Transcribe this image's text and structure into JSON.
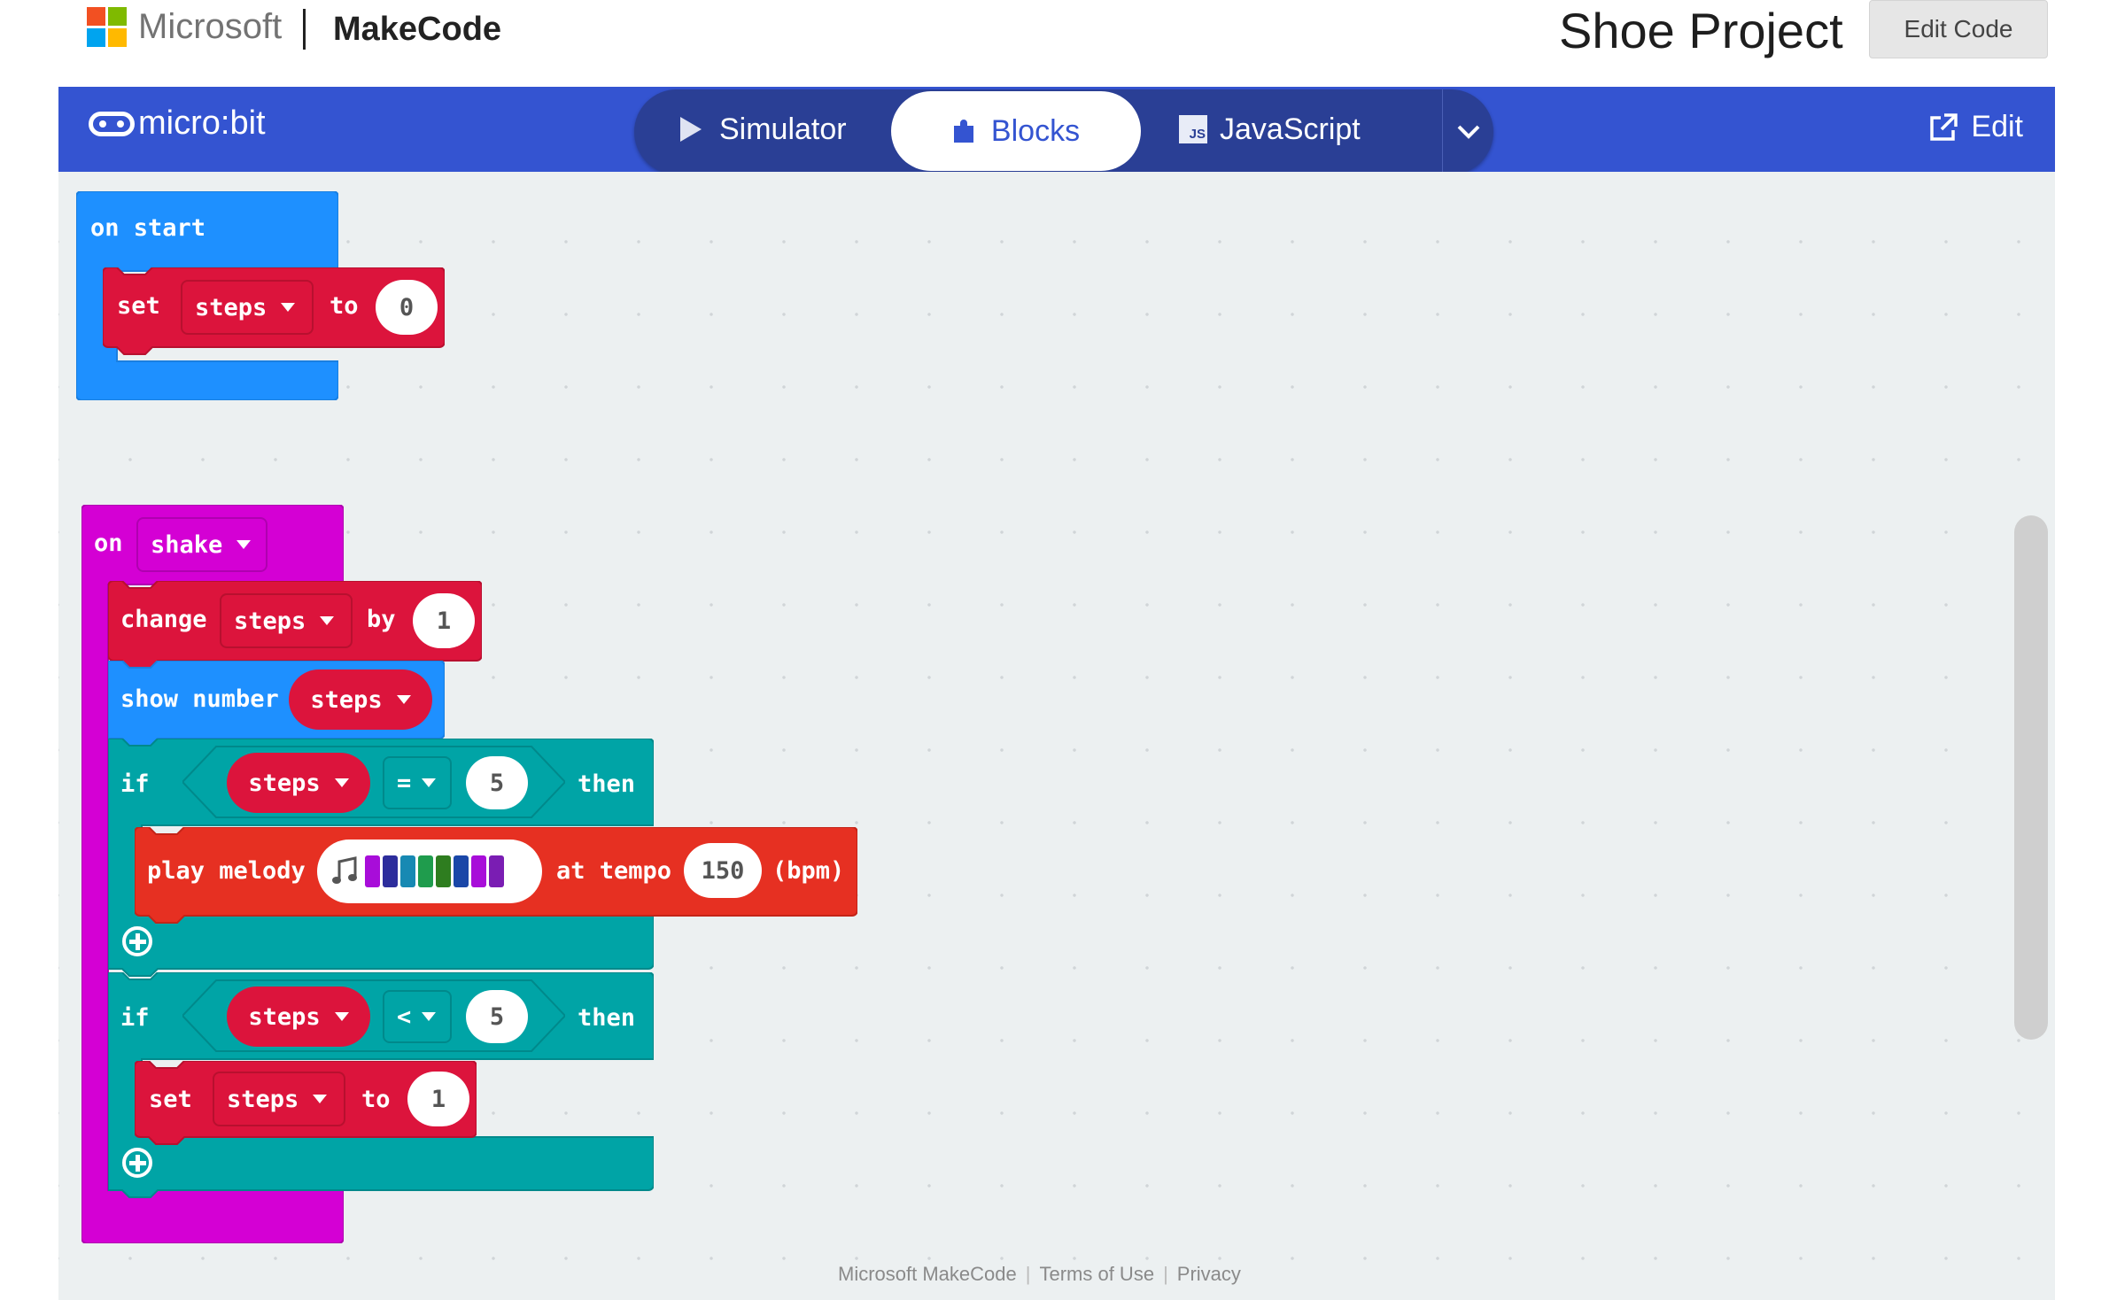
{
  "header": {
    "brand_company": "Microsoft",
    "brand_product": "MakeCode",
    "project_title": "Shoe Project",
    "edit_code_label": "Edit Code"
  },
  "topbar": {
    "logo_text": "micro:bit",
    "tabs": [
      {
        "label": "Simulator",
        "icon": "play-icon"
      },
      {
        "label": "Blocks",
        "icon": "puzzle-icon",
        "active": true
      },
      {
        "label": "JavaScript",
        "icon": "js-icon"
      }
    ],
    "js_badge": "JS",
    "edit_label": "Edit"
  },
  "blocks": {
    "on_start": {
      "label": "on start",
      "set_kw": "set",
      "var": "steps",
      "to_kw": "to",
      "value": "0"
    },
    "on_shake": {
      "on_kw": "on",
      "gesture": "shake",
      "change_kw": "change",
      "change_var": "steps",
      "by_kw": "by",
      "change_value": "1",
      "show_number": "show number",
      "show_var": "steps",
      "if1": {
        "if_kw": "if",
        "var": "steps",
        "op": "=",
        "value": "5",
        "then_kw": "then"
      },
      "melody": {
        "play_kw": "play melody",
        "at_tempo": "at tempo",
        "tempo": "150",
        "unit": "(bpm)",
        "colors": [
          "#a80dd9",
          "#2d2d9c",
          "#1789b3",
          "#1f9c4d",
          "#2e7d1f",
          "#1a47a8",
          "#a80dd9",
          "#7a1db3"
        ]
      },
      "if2": {
        "if_kw": "if",
        "var": "steps",
        "op": "<",
        "value": "5",
        "then_kw": "then"
      },
      "set2": {
        "set_kw": "set",
        "var": "steps",
        "to_kw": "to",
        "value": "1"
      }
    }
  },
  "footer": {
    "links": [
      "Microsoft MakeCode",
      "Terms of Use",
      "Privacy"
    ]
  },
  "colors": {
    "brand_blue": "#3454d1",
    "events_blue": "#1e90ff",
    "variables_red": "#dc143c",
    "input_magenta": "#d400d4",
    "logic_teal": "#00a4a6",
    "music_orange": "#e63022"
  }
}
